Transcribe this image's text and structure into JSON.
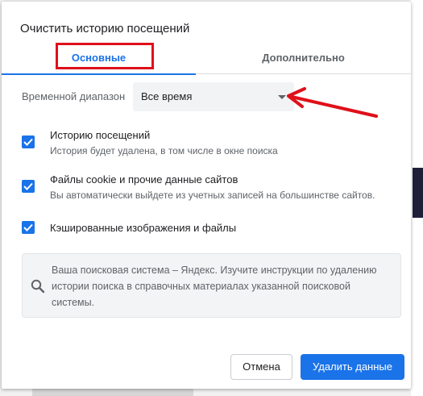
{
  "dialog": {
    "title": "Очистить историю посещений"
  },
  "tabs": [
    {
      "label": "Основные",
      "active": true
    },
    {
      "label": "Дополнительно",
      "active": false
    }
  ],
  "time_range": {
    "label": "Временной диапазон",
    "selected": "Все время"
  },
  "options": [
    {
      "title": "Историю посещений",
      "description": "История будет удалена, в том числе в окне поиска",
      "checked": true
    },
    {
      "title": "Файлы cookie и прочие данные сайтов",
      "description": "Вы автоматически выйдете из учетных записей на большинстве сайтов.",
      "checked": true
    },
    {
      "title": "Кэшированные изображения и файлы",
      "description": "",
      "checked": true
    }
  ],
  "info": {
    "icon": "search-icon",
    "text": "Ваша поисковая система – Яндекс. Изучите инструкции по удалению истории поиска в справочных материалах указанной поисковой системы."
  },
  "buttons": {
    "cancel": "Отмена",
    "delete": "Удалить данные"
  },
  "colors": {
    "accent": "#1a73e8",
    "annotation": "#e0101a"
  }
}
